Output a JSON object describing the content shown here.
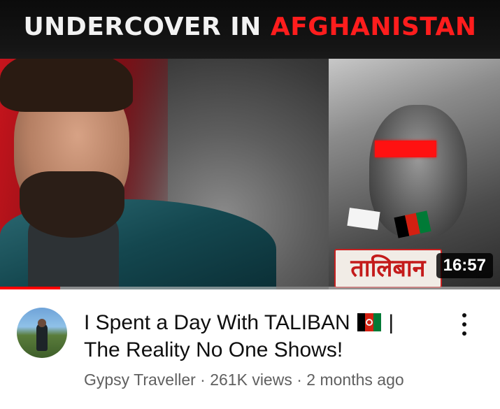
{
  "thumbnail": {
    "headline_part1": "UNDERCOVER IN",
    "headline_part2": "AFGHANISTAN",
    "badge_text": "तालिबान",
    "duration": "16:57",
    "watch_progress": 0.12
  },
  "video": {
    "title_part1": "I Spent a Day With TALIBAN",
    "title_flag_icon": "afghanistan-flag-icon",
    "title_part2": "|",
    "title_part3": "The Reality No One Shows!",
    "channel": "Gypsy Traveller",
    "separator": "·",
    "views": "261K views",
    "age": "2 months ago"
  },
  "icons": {
    "more": "more-vertical-icon",
    "avatar": "channel-avatar"
  },
  "colors": {
    "accent_red": "#ff1d1d",
    "progress_red": "#ff0000",
    "title_text": "#0f0f0f",
    "meta_text": "#606060"
  }
}
